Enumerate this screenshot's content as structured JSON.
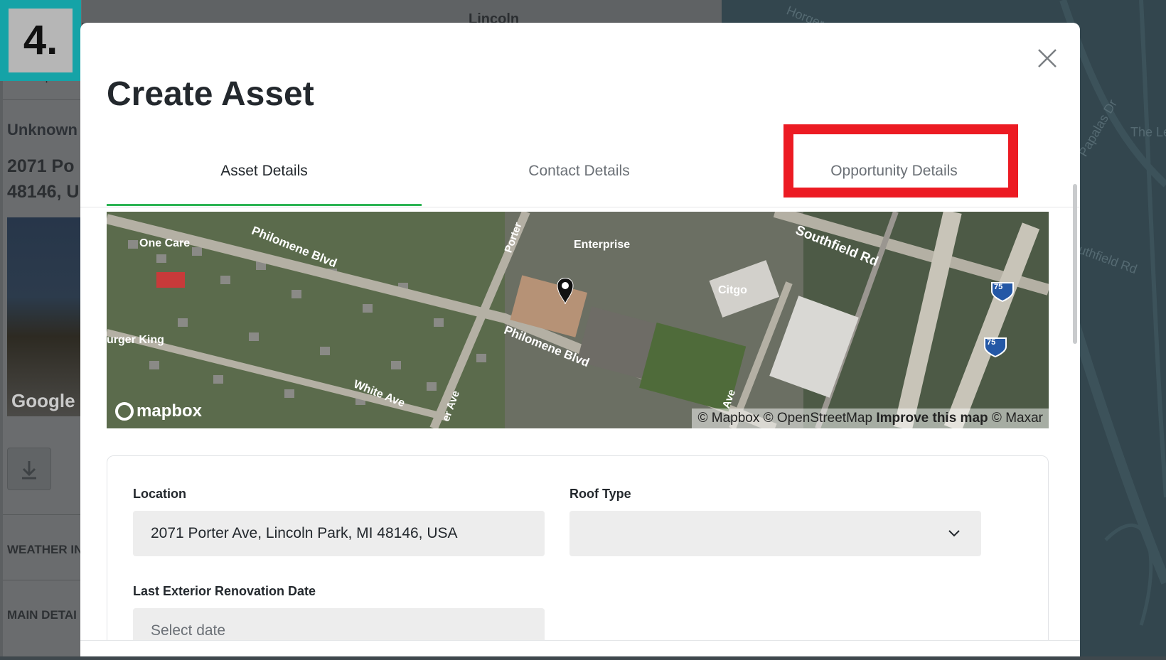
{
  "step_badge": "4.",
  "background": {
    "maps_label": "Maps",
    "unknown_label": "Unknown",
    "address_line1": "2071 Po",
    "address_line2": "48146, U",
    "google_label": "Google",
    "weather_label": "WEATHER IN",
    "main_details_label": "MAIN DETAI",
    "top_street": "Lincoln",
    "right_streets": [
      "Horger",
      "Papalas Dr",
      "The Le",
      "uthfield Rd"
    ]
  },
  "modal": {
    "title": "Create Asset",
    "close_icon": "close-icon",
    "tabs": [
      {
        "label": "Asset Details",
        "active": true
      },
      {
        "label": "Contact Details",
        "active": false
      },
      {
        "label": "Opportunity Details",
        "active": false
      }
    ],
    "highlight_color": "#ec1b23",
    "accent_color": "#2db454",
    "map": {
      "labels": [
        "One Care",
        "Philomene Blvd",
        "Porter",
        "Enterprise",
        "Southfield Rd",
        "Citgo",
        "urger King",
        "Philomene Blvd",
        "White Ave",
        "er Ave",
        "Ave"
      ],
      "shields": [
        "75",
        "75"
      ],
      "logo": "mapbox",
      "attribution": {
        "part1": "© Mapbox © OpenStreetMap",
        "improve": "Improve this map",
        "part2": "© Maxar"
      }
    },
    "form": {
      "location_label": "Location",
      "location_value": "2071 Porter Ave, Lincoln Park, MI 48146, USA",
      "roof_type_label": "Roof Type",
      "roof_type_value": "",
      "renovation_label": "Last Exterior Renovation Date",
      "renovation_placeholder": "Select date"
    }
  }
}
